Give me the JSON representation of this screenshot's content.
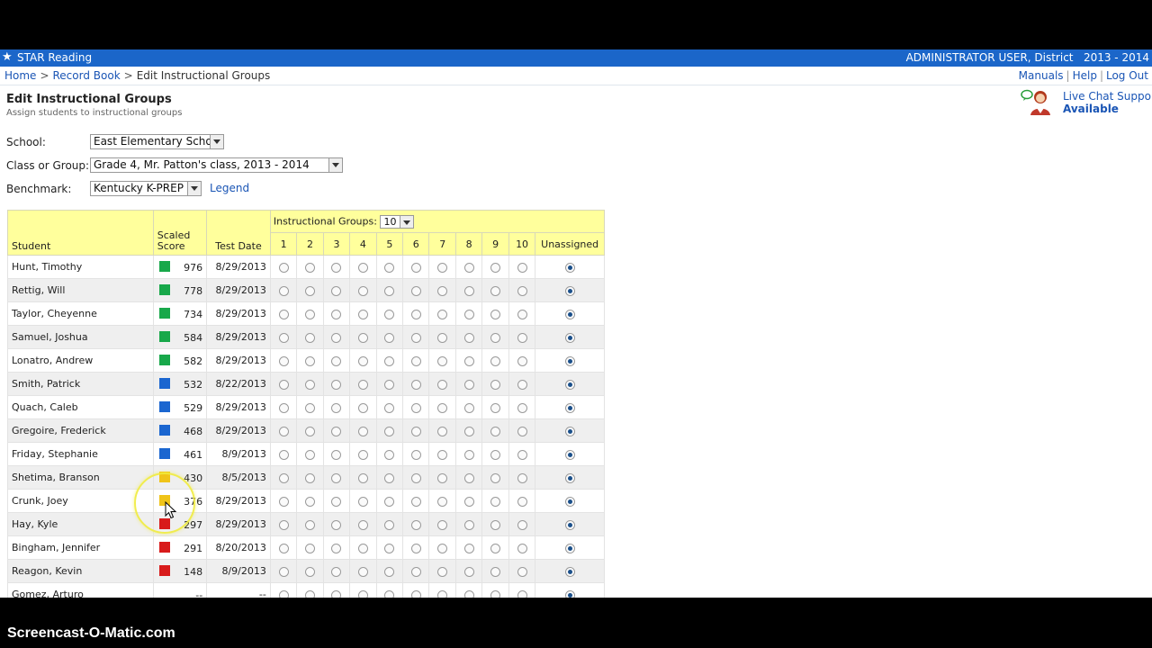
{
  "header": {
    "app_name": "STAR Reading",
    "user_info": "ADMINISTRATOR USER, District   2013 - 2014"
  },
  "breadcrumb": [
    "Home",
    "Record Book",
    "Edit Instructional Groups"
  ],
  "top_links": [
    "Manuals",
    "Help",
    "Log Out"
  ],
  "page": {
    "title": "Edit Instructional Groups",
    "subtitle": "Assign students to instructional groups"
  },
  "chat": {
    "line1": "Live Chat Support",
    "line2": "Available",
    "icon": "live-chat-agent-icon"
  },
  "filters": {
    "school_label": "School:",
    "school_value": "East Elementary School",
    "class_label": "Class or Group:",
    "class_value": "Grade 4, Mr. Patton's class, 2013 - 2014",
    "benchmark_label": "Benchmark:",
    "benchmark_value": "Kentucky K-PREP",
    "legend_link": "Legend"
  },
  "table": {
    "col_student": "Student",
    "col_scaled_1": "Scaled",
    "col_scaled_2": "Score",
    "col_test_date": "Test Date",
    "groups_label": "Instructional Groups:",
    "groups_count": "10",
    "group_numbers": [
      "1",
      "2",
      "3",
      "4",
      "5",
      "6",
      "7",
      "8",
      "9",
      "10"
    ],
    "col_unassigned": "Unassigned",
    "benchmark_colors": {
      "green": "#18a84a",
      "blue": "#1b66d0",
      "yellow": "#f0c419",
      "red": "#d81b1b"
    },
    "rows": [
      {
        "name": "Hunt, Timothy",
        "score": "976",
        "date": "8/29/2013",
        "color": "#18a84a"
      },
      {
        "name": "Rettig, Will",
        "score": "778",
        "date": "8/29/2013",
        "color": "#18a84a"
      },
      {
        "name": "Taylor, Cheyenne",
        "score": "734",
        "date": "8/29/2013",
        "color": "#18a84a"
      },
      {
        "name": "Samuel, Joshua",
        "score": "584",
        "date": "8/29/2013",
        "color": "#18a84a"
      },
      {
        "name": "Lonatro, Andrew",
        "score": "582",
        "date": "8/29/2013",
        "color": "#18a84a"
      },
      {
        "name": "Smith, Patrick",
        "score": "532",
        "date": "8/22/2013",
        "color": "#1b66d0"
      },
      {
        "name": "Quach, Caleb",
        "score": "529",
        "date": "8/29/2013",
        "color": "#1b66d0"
      },
      {
        "name": "Gregoire, Frederick",
        "score": "468",
        "date": "8/29/2013",
        "color": "#1b66d0"
      },
      {
        "name": "Friday, Stephanie",
        "score": "461",
        "date": "8/9/2013",
        "color": "#1b66d0"
      },
      {
        "name": "Shetima, Branson",
        "score": "430",
        "date": "8/5/2013",
        "color": "#f0c419"
      },
      {
        "name": "Crunk, Joey",
        "score": "376",
        "date": "8/29/2013",
        "color": "#f0c419"
      },
      {
        "name": "Hay, Kyle",
        "score": "297",
        "date": "8/29/2013",
        "color": "#d81b1b"
      },
      {
        "name": "Bingham, Jennifer",
        "score": "291",
        "date": "8/20/2013",
        "color": "#d81b1b"
      },
      {
        "name": "Reagon, Kevin",
        "score": "148",
        "date": "8/9/2013",
        "color": "#d81b1b"
      },
      {
        "name": "Gomez, Arturo",
        "score": "--",
        "date": "--",
        "color": null
      }
    ]
  },
  "watermark": "Screencast-O-Matic.com"
}
